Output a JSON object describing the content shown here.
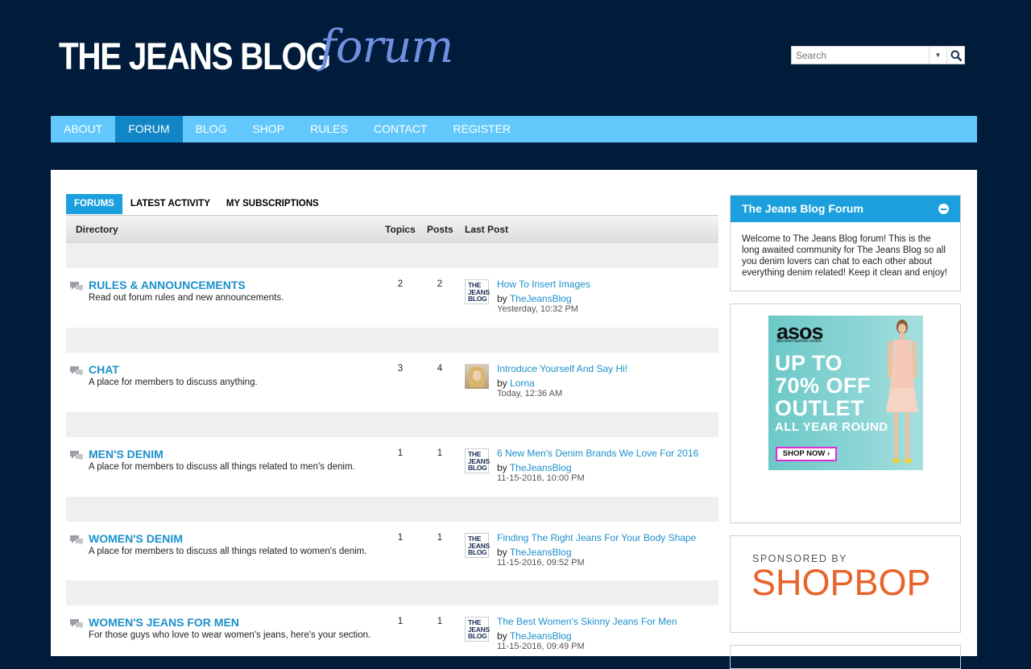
{
  "header": {
    "logo_main": "THE JEANS BLOG",
    "logo_script": "forum",
    "search": {
      "placeholder": "Search"
    }
  },
  "nav": {
    "items": [
      "ABOUT",
      "FORUM",
      "BLOG",
      "SHOP",
      "RULES",
      "CONTACT",
      "REGISTER"
    ],
    "active": "FORUM"
  },
  "tabs": [
    "FORUMS",
    "LATEST ACTIVITY",
    "MY SUBSCRIPTIONS"
  ],
  "table_header": {
    "directory": "Directory",
    "topics": "Topics",
    "posts": "Posts",
    "last_post": "Last Post"
  },
  "forums": [
    {
      "title": "RULES & ANNOUNCEMENTS",
      "description": "Read out forum rules and new announcements.",
      "topics": "2",
      "posts": "2",
      "last_post": {
        "title": "How To Insert Images",
        "by": "by",
        "user": "TheJeansBlog",
        "date": "Yesterday, 10:32 PM",
        "avatar": "tjb-logo"
      }
    },
    {
      "title": "CHAT",
      "description": "A place for members to discuss anything.",
      "topics": "3",
      "posts": "4",
      "last_post": {
        "title": "Introduce Yourself And Say Hi!",
        "by": "by",
        "user": "Lorna",
        "date": "Today, 12:36 AM",
        "avatar": "user-photo"
      }
    },
    {
      "title": "MEN'S DENIM",
      "description": "A place for members to discuss all things related to men's denim.",
      "topics": "1",
      "posts": "1",
      "last_post": {
        "title": "6 New Men's Denim Brands We Love For 2016",
        "by": "by",
        "user": "TheJeansBlog",
        "date": "11-15-2016, 10:00 PM",
        "avatar": "tjb-logo"
      }
    },
    {
      "title": "WOMEN'S DENIM",
      "description": "A place for members to discuss all things related to women's denim.",
      "topics": "1",
      "posts": "1",
      "last_post": {
        "title": "Finding The Right Jeans For Your Body Shape",
        "by": "by",
        "user": "TheJeansBlog",
        "date": "11-15-2016, 09:52 PM",
        "avatar": "tjb-logo"
      }
    },
    {
      "title": "WOMEN'S JEANS FOR MEN",
      "description": "For those guys who love to wear women's jeans, here's your section.",
      "topics": "1",
      "posts": "1",
      "last_post": {
        "title": "The Best Women's Skinny Jeans For Men",
        "by": "by",
        "user": "TheJeansBlog",
        "date": "11-15-2016, 09:49 PM",
        "avatar": "tjb-logo"
      }
    }
  ],
  "thumb_logo_lines": [
    "THE",
    "JEANS",
    "BLOG"
  ],
  "sidebar": {
    "welcome_title": "The Jeans Blog Forum",
    "welcome_text": "Welcome to The Jeans Blog forum! This is the long awaited community for The Jeans Blog so all you denim lovers can chat to each other about everything denim related! Keep it clean and enjoy!",
    "ad": {
      "brand": "asos",
      "tagline": "discover fashion online",
      "line1": "UP TO",
      "line2": "70% OFF",
      "line3": "OUTLET",
      "line4": "ALL YEAR ROUND",
      "cta": "SHOP NOW ›"
    },
    "sponsor_label": "SPONSORED BY",
    "sponsor_name": "SHOPBOP"
  },
  "colors": {
    "background": "#001c3a",
    "nav": "#62c8fb",
    "nav_active": "#1186c7",
    "accent": "#1ba0dd",
    "link": "#1b90cb",
    "sponsor": "#e8642b"
  }
}
